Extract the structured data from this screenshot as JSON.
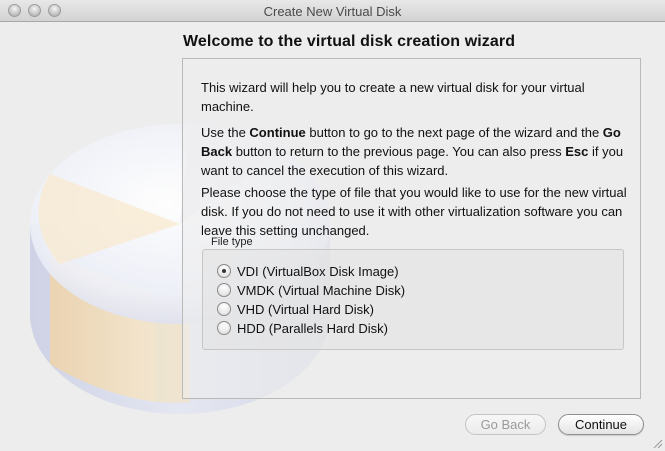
{
  "window": {
    "title": "Create New Virtual Disk"
  },
  "wizard": {
    "heading": "Welcome to the virtual disk creation wizard",
    "intro": "This wizard will help you to create a new virtual disk for your virtual machine.",
    "nav_text_1": "Use the ",
    "nav_continue": "Continue",
    "nav_text_2": " button to go to the next page of the wizard and the ",
    "nav_goback": "Go Back",
    "nav_text_3": " button to return to the previous page. You can also press ",
    "nav_esc": "Esc",
    "nav_text_4": " if you want to cancel the execution of this wizard.",
    "choose": "Please choose the type of file that you would like to use for the new virtual disk. If you do not need to use it with other virtualization software you can leave this setting unchanged."
  },
  "file_type": {
    "label": "File type",
    "options": [
      {
        "label": "VDI (VirtualBox Disk Image)",
        "checked": true
      },
      {
        "label": "VMDK (Virtual Machine Disk)",
        "checked": false
      },
      {
        "label": "VHD (Virtual Hard Disk)",
        "checked": false
      },
      {
        "label": "HDD (Parallels Hard Disk)",
        "checked": false
      }
    ]
  },
  "buttons": {
    "go_back": "Go Back",
    "continue": "Continue"
  }
}
